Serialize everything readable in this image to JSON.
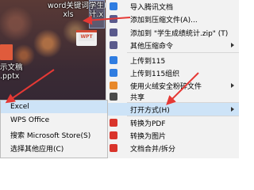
{
  "desktop": {
    "files": [
      {
        "label_line1": "word关键词",
        "label_line2": "xls"
      },
      {
        "label_line1": "学生成",
        "label_line2": "计.x"
      },
      {
        "label_line1": "示文稿",
        "label_line2": ".pptx"
      }
    ],
    "wpt_badge": "WPT"
  },
  "context_menu": {
    "items": [
      {
        "label": "导入腾讯文档",
        "icon": "tencent-docs-icon",
        "color": "#2f7de1"
      },
      {
        "label": "添加到压缩文件(A)...",
        "icon": "archive-icon",
        "color": "#5a5a8c"
      },
      {
        "label": "添加到 \"学生成绩统计.zip\" (T)",
        "icon": "zip-icon",
        "color": "#5a5a8c"
      },
      {
        "label": "其他压缩命令",
        "icon": "archive-more-icon",
        "color": "#5a5a8c",
        "submenu": true
      },
      {
        "label": "上传到115",
        "icon": "cloud-115-icon",
        "color": "#2f7de1"
      },
      {
        "label": "上传到115组织",
        "icon": "cloud-115-org-icon",
        "color": "#2f7de1"
      },
      {
        "label": "使用火绒安全粉碎文件",
        "icon": "shred-icon",
        "color": "#e8882a",
        "submenu": true
      },
      {
        "label": "共享",
        "icon": "share-icon",
        "color": "#4a4a4a"
      },
      {
        "label": "打开方式(H)",
        "icon": "",
        "color": "",
        "submenu": true
      },
      {
        "label": "转换为PDF",
        "icon": "pdf-icon",
        "color": "#d9342b"
      },
      {
        "label": "转换为图片",
        "icon": "image-convert-icon",
        "color": "#d9342b"
      },
      {
        "label": "文档合并/拆分",
        "icon": "merge-split-icon",
        "color": "#d9342b"
      }
    ]
  },
  "open_with_submenu": {
    "items": [
      {
        "label": "Excel"
      },
      {
        "label": "WPS Office"
      },
      {
        "label": "搜索 Microsoft Store(S)"
      },
      {
        "label": "选择其他应用(C)"
      }
    ]
  },
  "colors": {
    "annotation_arrow": "#e53935",
    "highlight": "#cde3f7"
  }
}
